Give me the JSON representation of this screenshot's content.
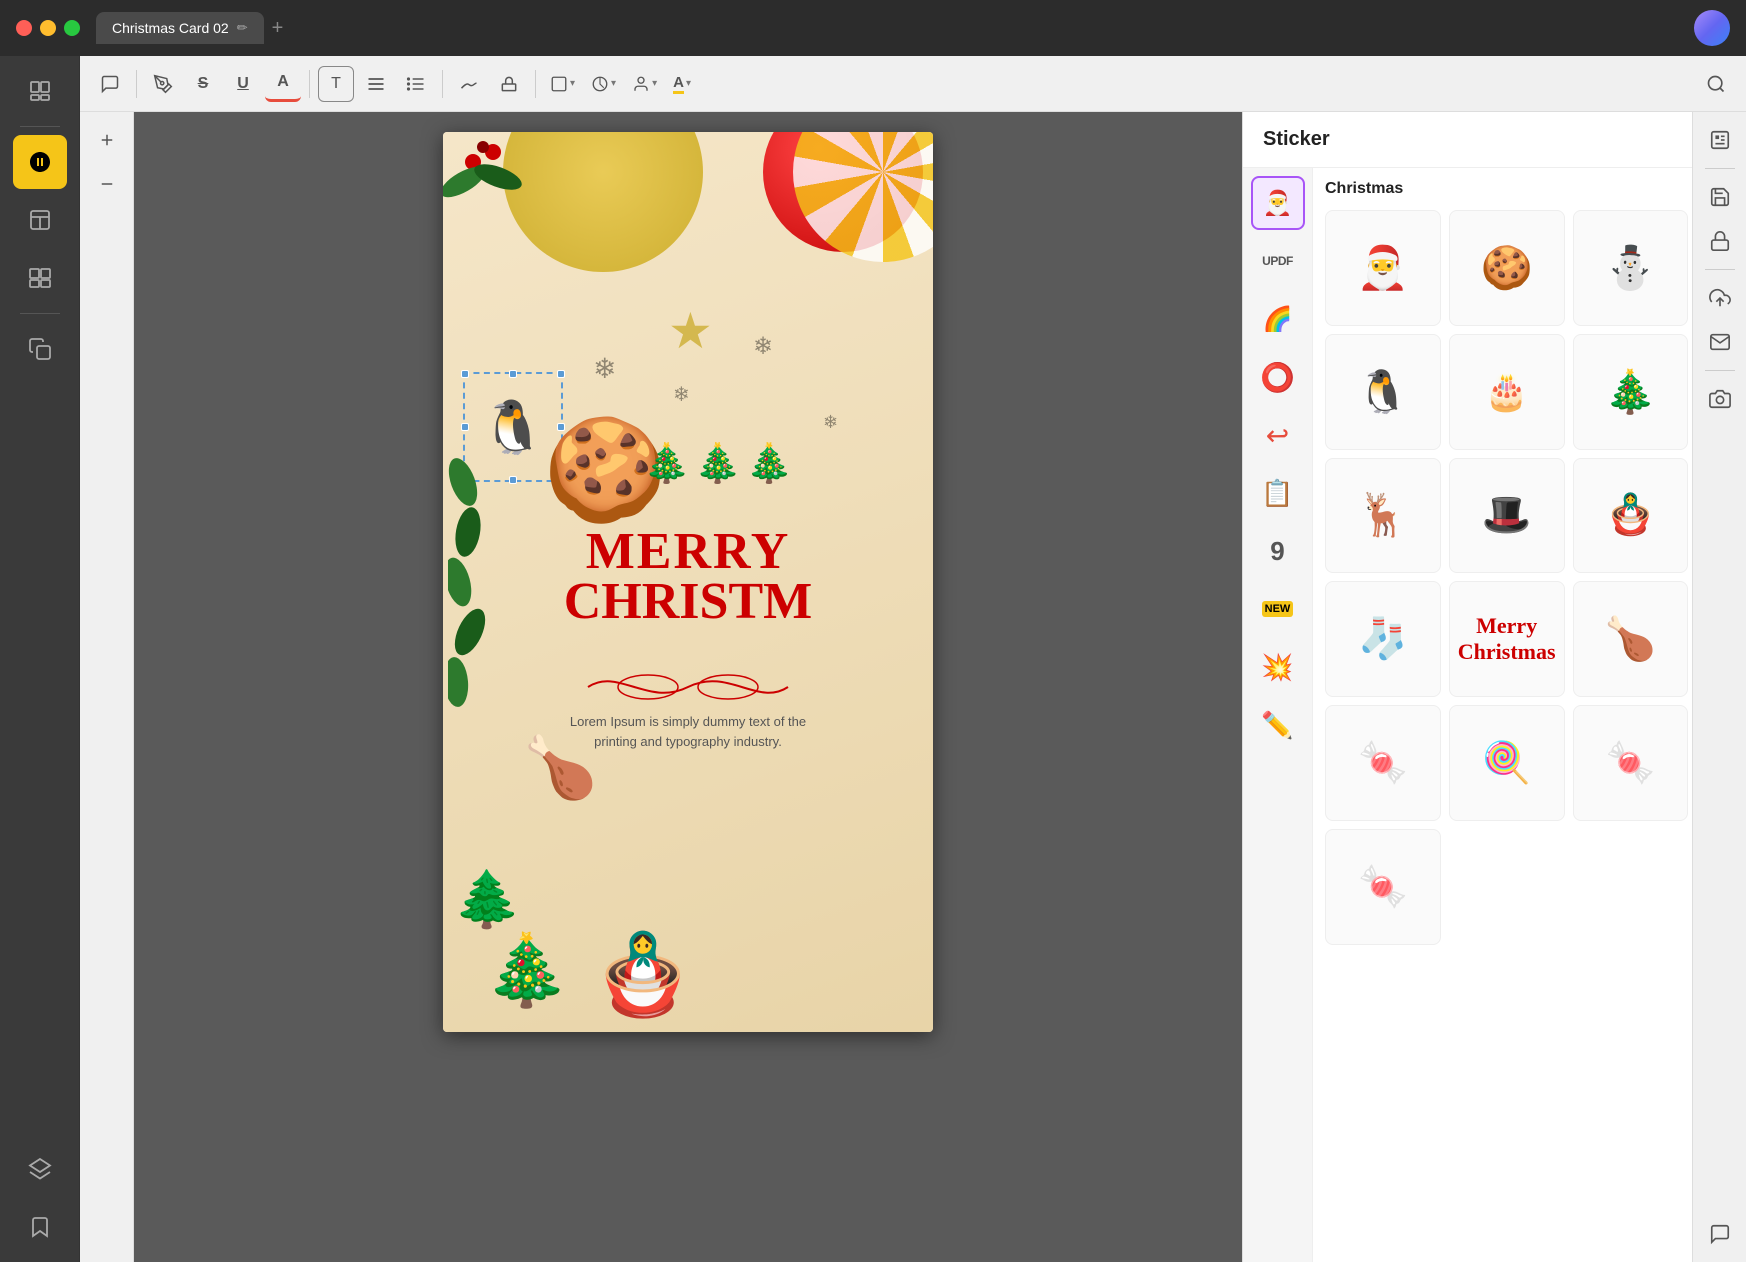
{
  "titleBar": {
    "title": "Christmas Card 02",
    "addTabLabel": "+",
    "editIcon": "✏"
  },
  "toolbar": {
    "buttons": [
      {
        "name": "comment",
        "icon": "💬"
      },
      {
        "name": "pen",
        "icon": "✒"
      },
      {
        "name": "strikethrough",
        "icon": "S"
      },
      {
        "name": "underline",
        "icon": "U"
      },
      {
        "name": "text-color",
        "icon": "A"
      },
      {
        "name": "text-box",
        "icon": "T"
      },
      {
        "name": "text-format",
        "icon": "T₂"
      },
      {
        "name": "list",
        "icon": "☰"
      },
      {
        "name": "signature",
        "icon": "∫"
      },
      {
        "name": "stamp",
        "icon": "⬒"
      },
      {
        "name": "shape",
        "icon": "▭"
      },
      {
        "name": "draw-color",
        "icon": "⬤"
      },
      {
        "name": "user",
        "icon": "👤"
      },
      {
        "name": "text-highlight",
        "icon": "A▾"
      },
      {
        "name": "search",
        "icon": "🔍"
      }
    ]
  },
  "panel": {
    "title": "Sticker",
    "categoryLabel": "Christmas",
    "categories": [
      {
        "id": "christmas",
        "label": "Christmas",
        "icon": "🎅",
        "active": true
      },
      {
        "id": "updf",
        "label": "UPDF",
        "icon": "📄"
      },
      {
        "id": "emoji",
        "label": "Emoji",
        "icon": "🌈"
      },
      {
        "id": "shapes",
        "label": "Shapes",
        "icon": "⭕"
      },
      {
        "id": "arrows",
        "label": "Arrows",
        "icon": "↩"
      },
      {
        "id": "paper",
        "label": "Paper",
        "icon": "📋"
      },
      {
        "id": "numbers",
        "label": "Numbers",
        "icon": "9"
      },
      {
        "id": "labels",
        "label": "Labels",
        "icon": "🏷"
      },
      {
        "id": "burst",
        "label": "Burst",
        "icon": "💥"
      },
      {
        "id": "pencil",
        "label": "Pencil",
        "icon": "✏"
      }
    ],
    "stickers": [
      {
        "id": "santa",
        "label": "Santa Claus",
        "emoji": "🎅"
      },
      {
        "id": "gingerbread",
        "label": "Gingerbread Man",
        "emoji": "🍪"
      },
      {
        "id": "snowman",
        "label": "Snowman",
        "emoji": "⛄"
      },
      {
        "id": "penguin",
        "label": "Penguin",
        "emoji": "🐧"
      },
      {
        "id": "christmas-pudding",
        "label": "Christmas Pudding",
        "emoji": "🎂"
      },
      {
        "id": "christmas-tree",
        "label": "Christmas Tree",
        "emoji": "🎄"
      },
      {
        "id": "reindeer",
        "label": "Reindeer",
        "emoji": "🦌"
      },
      {
        "id": "santa-hat",
        "label": "Santa Hat",
        "emoji": "🎩"
      },
      {
        "id": "nutcracker",
        "label": "Nutcracker",
        "emoji": "🪆"
      },
      {
        "id": "stocking",
        "label": "Christmas Stocking",
        "emoji": "🧦"
      },
      {
        "id": "merry-christmas-text",
        "label": "Merry Christmas Text",
        "text": "Merry\nChristmas"
      },
      {
        "id": "turkey",
        "label": "Turkey",
        "emoji": "🍗"
      },
      {
        "id": "candy-cane-red",
        "label": "Candy Cane Red",
        "emoji": "🍬"
      },
      {
        "id": "candy-cane-gold",
        "label": "Candy Cane Gold",
        "emoji": "🍭"
      },
      {
        "id": "candy-cane-blue",
        "label": "Candy Cane Blue",
        "emoji": "🍬"
      },
      {
        "id": "candy-cane-green",
        "label": "Candy Cane Green",
        "emoji": "🍬"
      }
    ]
  },
  "card": {
    "title": "Christmas Card",
    "merryText": "MERRY",
    "christmasText": "CHRISTM",
    "loremText": "Lorem Ipsum is simply dummy text of the printing and typography industry."
  },
  "sidebar": {
    "items": [
      {
        "id": "pages",
        "icon": "pages-icon",
        "active": false
      },
      {
        "id": "sticker",
        "icon": "sticker-icon",
        "active": true
      },
      {
        "id": "template",
        "icon": "template-icon",
        "active": false
      },
      {
        "id": "layout",
        "icon": "layout-icon",
        "active": false
      },
      {
        "id": "layers",
        "icon": "layers-icon",
        "active": false
      },
      {
        "id": "bookmark",
        "icon": "bookmark-icon",
        "active": false
      }
    ]
  },
  "rightRail": {
    "buttons": [
      {
        "id": "ocr",
        "label": "OCR"
      },
      {
        "id": "save",
        "label": "Save"
      },
      {
        "id": "lock",
        "label": "Lock"
      },
      {
        "id": "upload",
        "label": "Upload"
      },
      {
        "id": "email",
        "label": "Email"
      },
      {
        "id": "camera",
        "label": "Camera"
      },
      {
        "id": "chat",
        "label": "Chat"
      }
    ]
  }
}
